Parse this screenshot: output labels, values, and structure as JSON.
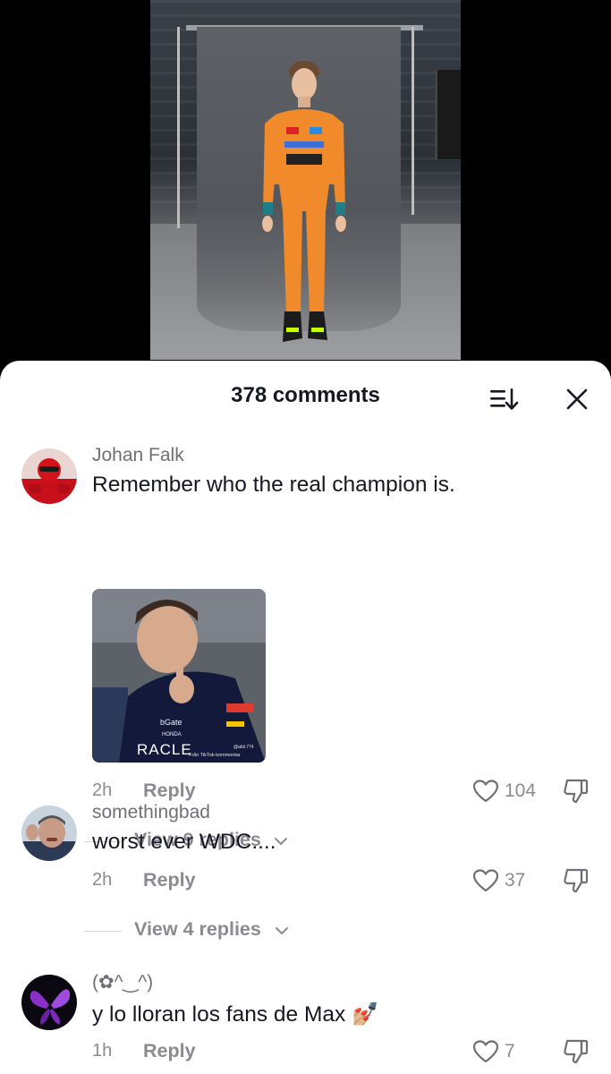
{
  "header": {
    "comments_title": "378 comments"
  },
  "icons": {
    "sort": "sort-icon",
    "close": "close-icon",
    "like": "heart-outline-icon",
    "dislike": "thumbs-down-icon",
    "chevron": "chevron-down-icon"
  },
  "colors": {
    "text": "#161823",
    "muted": "#8a8b91",
    "driver_suit": "#f08a2a"
  },
  "comments": [
    {
      "username": "Johan Falk",
      "text": "Remember who the real champion is.",
      "time": "2h",
      "reply_label": "Reply",
      "likes": "104",
      "view_replies": "View 9 replies",
      "image_text": {
        "sponsor_1": "bGate",
        "sponsor_2": "HONDA",
        "sponsor_3": "RACLE",
        "watermark": "Från TikTok-kommentar",
        "handle": "@abli.774"
      }
    },
    {
      "username": "somethingbad",
      "text": "worst ever WDC....",
      "time": "2h",
      "reply_label": "Reply",
      "likes": "37",
      "view_replies": "View 4 replies"
    },
    {
      "username": "(✿^‿^)",
      "text": "y lo lloran los fans de Max 💅🏼",
      "time": "1h",
      "reply_label": "Reply",
      "likes": "7"
    }
  ]
}
